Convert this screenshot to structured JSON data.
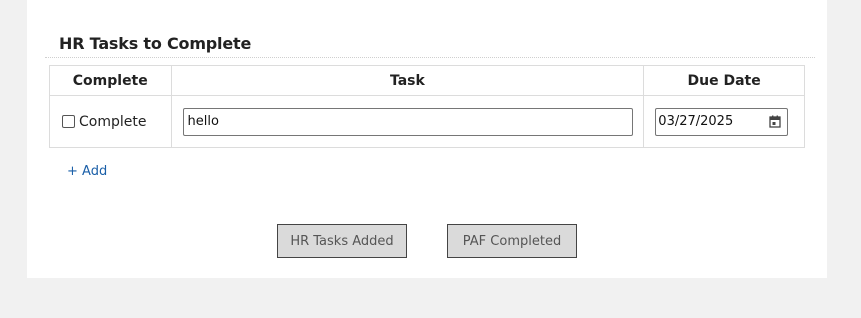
{
  "section": {
    "title": "HR Tasks to Complete"
  },
  "table": {
    "headers": [
      "Complete",
      "Task",
      "Due Date"
    ],
    "rows": [
      {
        "complete_label": "Complete",
        "checked": false,
        "task": "hello",
        "due_date": "03/27/2025"
      }
    ]
  },
  "add_link": "+ Add",
  "buttons": {
    "hr_tasks_added": "HR Tasks Added",
    "paf_completed": "PAF Completed"
  },
  "icons": {
    "date_picker": "calendar-icon"
  },
  "colors": {
    "link": "#1a5fa8",
    "page_bg": "#f1f1f1",
    "button_bg": "#dadada"
  }
}
